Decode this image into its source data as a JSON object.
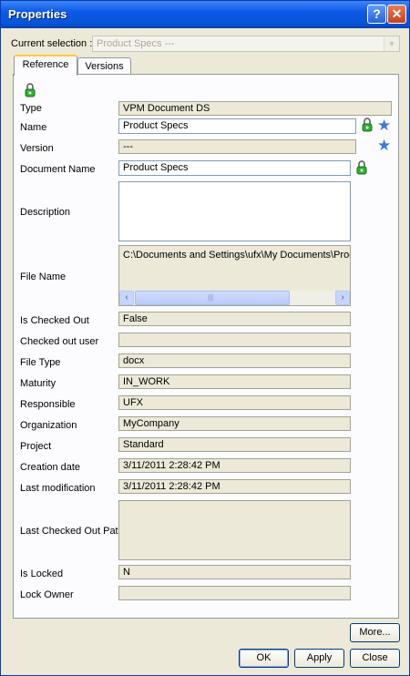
{
  "window": {
    "title": "Properties",
    "help_glyph": "?",
    "close_glyph": "✕"
  },
  "selection": {
    "label": "Current selection :",
    "value": "Product Specs ---"
  },
  "tabs": [
    {
      "label": "Reference"
    },
    {
      "label": "Versions"
    }
  ],
  "fields": {
    "type": {
      "label": "Type",
      "value": "VPM Document DS"
    },
    "name": {
      "label": "Name",
      "value": "Product Specs"
    },
    "version": {
      "label": "Version",
      "value": "---"
    },
    "document_name": {
      "label": "Document Name",
      "value": "Product Specs"
    },
    "description": {
      "label": "Description",
      "value": ""
    },
    "file_name": {
      "label": "File Name",
      "value": "C:\\Documents and Settings\\ufx\\My Documents\\Produ"
    },
    "is_checked_out": {
      "label": "Is Checked Out",
      "value": "False"
    },
    "checked_out_user": {
      "label": "Checked out user",
      "value": ""
    },
    "file_type": {
      "label": "File Type",
      "value": "docx"
    },
    "maturity": {
      "label": "Maturity",
      "value": "IN_WORK"
    },
    "responsible": {
      "label": "Responsible",
      "value": "UFX"
    },
    "organization": {
      "label": "Organization",
      "value": "MyCompany"
    },
    "project": {
      "label": "Project",
      "value": "Standard"
    },
    "creation_date": {
      "label": "Creation date",
      "value": "3/11/2011 2:28:42 PM"
    },
    "last_modification": {
      "label": "Last modification",
      "value": "3/11/2011 2:28:42 PM"
    },
    "last_checked_out_path": {
      "label": "Last Checked Out Path",
      "value": ""
    },
    "is_locked": {
      "label": "Is Locked",
      "value": "N"
    },
    "lock_owner": {
      "label": "Lock Owner",
      "value": ""
    }
  },
  "scrollbar": {
    "left": "‹",
    "right": "›",
    "grip": "|||"
  },
  "buttons": {
    "more": "More...",
    "ok": "OK",
    "apply": "Apply",
    "close": "Close"
  },
  "icons": {
    "lock": "lock-icon",
    "star": "star-icon"
  },
  "colors": {
    "titlebar": "#0854d6",
    "dialog_bg": "#ece9d8",
    "lock_green": "#2fb12f",
    "lock_red": "#d12b2b",
    "star": "#3d7ad6"
  }
}
